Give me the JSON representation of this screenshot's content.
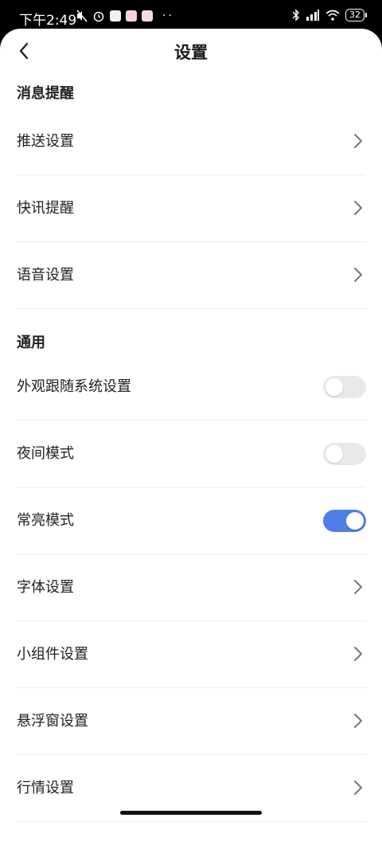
{
  "statusbar": {
    "time": "下午2:49",
    "dots": "··",
    "battery": "32"
  },
  "nav": {
    "title": "设置"
  },
  "sections": {
    "notifications": {
      "title": "消息提醒",
      "items": [
        {
          "label": "推送设置"
        },
        {
          "label": "快讯提醒"
        },
        {
          "label": "语音设置"
        }
      ]
    },
    "general": {
      "title": "通用",
      "items": [
        {
          "label": "外观跟随系统设置",
          "toggle": false
        },
        {
          "label": "夜间模式",
          "toggle": false
        },
        {
          "label": "常亮模式",
          "toggle": true
        },
        {
          "label": "字体设置"
        },
        {
          "label": "小组件设置"
        },
        {
          "label": "悬浮窗设置"
        },
        {
          "label": "行情设置"
        }
      ]
    }
  },
  "colors": {
    "accent": "#4f7fe6",
    "toggle_off": "#e9e9e9"
  }
}
